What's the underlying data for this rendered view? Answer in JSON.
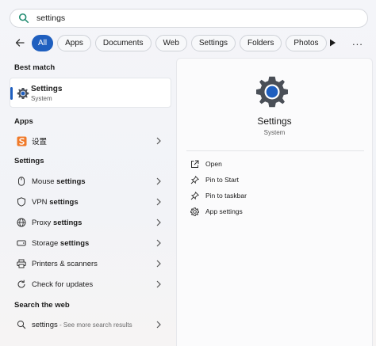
{
  "search": {
    "value": "settings",
    "placeholder": ""
  },
  "filters": {
    "chips": [
      "All",
      "Apps",
      "Documents",
      "Web",
      "Settings",
      "Folders",
      "Photos"
    ],
    "active": "All",
    "more_label": "..."
  },
  "left": {
    "best_match": {
      "heading": "Best match",
      "title": "Settings",
      "subtitle": "System"
    },
    "apps": {
      "heading": "Apps",
      "items": [
        {
          "label": "设置"
        }
      ]
    },
    "settings": {
      "heading": "Settings",
      "items": [
        {
          "pre": "Mouse ",
          "bold": "settings",
          "post": ""
        },
        {
          "pre": "VPN ",
          "bold": "settings",
          "post": ""
        },
        {
          "pre": "Proxy ",
          "bold": "settings",
          "post": ""
        },
        {
          "pre": "Storage ",
          "bold": "settings",
          "post": ""
        },
        {
          "pre": "Printers & scanners",
          "bold": "",
          "post": ""
        },
        {
          "pre": "Check for updates",
          "bold": "",
          "post": ""
        }
      ]
    },
    "web": {
      "heading": "Search the web",
      "query": "settings",
      "hint": " - See more search results"
    }
  },
  "right": {
    "title": "Settings",
    "subtitle": "System",
    "actions": [
      "Open",
      "Pin to Start",
      "Pin to taskbar",
      "App settings"
    ]
  },
  "colors": {
    "accent": "#1f5fbf",
    "gear": "#4a4f57",
    "gear_center": "#1f5fbf"
  }
}
